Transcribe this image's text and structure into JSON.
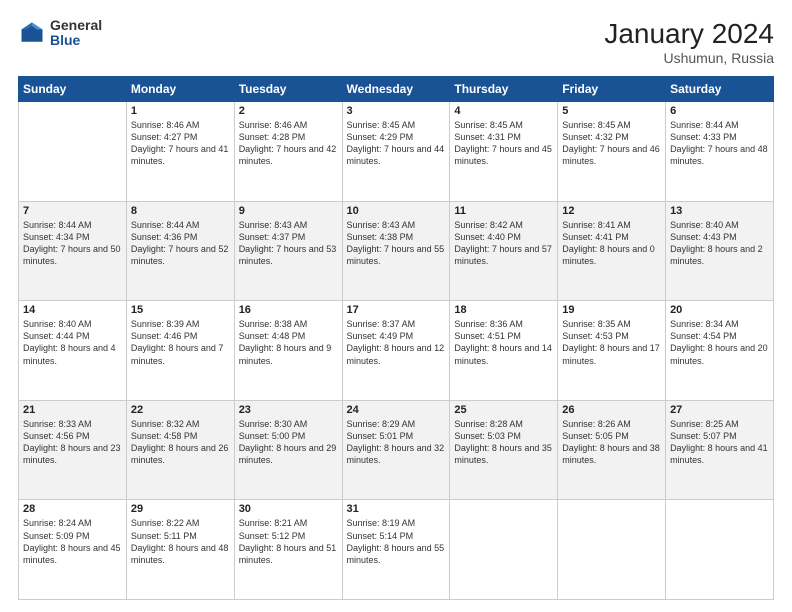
{
  "header": {
    "logo_general": "General",
    "logo_blue": "Blue",
    "main_title": "January 2024",
    "subtitle": "Ushumun, Russia"
  },
  "days_of_week": [
    "Sunday",
    "Monday",
    "Tuesday",
    "Wednesday",
    "Thursday",
    "Friday",
    "Saturday"
  ],
  "weeks": [
    [
      {
        "day": "",
        "sunrise": "",
        "sunset": "",
        "daylight": ""
      },
      {
        "day": "1",
        "sunrise": "Sunrise: 8:46 AM",
        "sunset": "Sunset: 4:27 PM",
        "daylight": "Daylight: 7 hours and 41 minutes."
      },
      {
        "day": "2",
        "sunrise": "Sunrise: 8:46 AM",
        "sunset": "Sunset: 4:28 PM",
        "daylight": "Daylight: 7 hours and 42 minutes."
      },
      {
        "day": "3",
        "sunrise": "Sunrise: 8:45 AM",
        "sunset": "Sunset: 4:29 PM",
        "daylight": "Daylight: 7 hours and 44 minutes."
      },
      {
        "day": "4",
        "sunrise": "Sunrise: 8:45 AM",
        "sunset": "Sunset: 4:31 PM",
        "daylight": "Daylight: 7 hours and 45 minutes."
      },
      {
        "day": "5",
        "sunrise": "Sunrise: 8:45 AM",
        "sunset": "Sunset: 4:32 PM",
        "daylight": "Daylight: 7 hours and 46 minutes."
      },
      {
        "day": "6",
        "sunrise": "Sunrise: 8:44 AM",
        "sunset": "Sunset: 4:33 PM",
        "daylight": "Daylight: 7 hours and 48 minutes."
      }
    ],
    [
      {
        "day": "7",
        "sunrise": "Sunrise: 8:44 AM",
        "sunset": "Sunset: 4:34 PM",
        "daylight": "Daylight: 7 hours and 50 minutes."
      },
      {
        "day": "8",
        "sunrise": "Sunrise: 8:44 AM",
        "sunset": "Sunset: 4:36 PM",
        "daylight": "Daylight: 7 hours and 52 minutes."
      },
      {
        "day": "9",
        "sunrise": "Sunrise: 8:43 AM",
        "sunset": "Sunset: 4:37 PM",
        "daylight": "Daylight: 7 hours and 53 minutes."
      },
      {
        "day": "10",
        "sunrise": "Sunrise: 8:43 AM",
        "sunset": "Sunset: 4:38 PM",
        "daylight": "Daylight: 7 hours and 55 minutes."
      },
      {
        "day": "11",
        "sunrise": "Sunrise: 8:42 AM",
        "sunset": "Sunset: 4:40 PM",
        "daylight": "Daylight: 7 hours and 57 minutes."
      },
      {
        "day": "12",
        "sunrise": "Sunrise: 8:41 AM",
        "sunset": "Sunset: 4:41 PM",
        "daylight": "Daylight: 8 hours and 0 minutes."
      },
      {
        "day": "13",
        "sunrise": "Sunrise: 8:40 AM",
        "sunset": "Sunset: 4:43 PM",
        "daylight": "Daylight: 8 hours and 2 minutes."
      }
    ],
    [
      {
        "day": "14",
        "sunrise": "Sunrise: 8:40 AM",
        "sunset": "Sunset: 4:44 PM",
        "daylight": "Daylight: 8 hours and 4 minutes."
      },
      {
        "day": "15",
        "sunrise": "Sunrise: 8:39 AM",
        "sunset": "Sunset: 4:46 PM",
        "daylight": "Daylight: 8 hours and 7 minutes."
      },
      {
        "day": "16",
        "sunrise": "Sunrise: 8:38 AM",
        "sunset": "Sunset: 4:48 PM",
        "daylight": "Daylight: 8 hours and 9 minutes."
      },
      {
        "day": "17",
        "sunrise": "Sunrise: 8:37 AM",
        "sunset": "Sunset: 4:49 PM",
        "daylight": "Daylight: 8 hours and 12 minutes."
      },
      {
        "day": "18",
        "sunrise": "Sunrise: 8:36 AM",
        "sunset": "Sunset: 4:51 PM",
        "daylight": "Daylight: 8 hours and 14 minutes."
      },
      {
        "day": "19",
        "sunrise": "Sunrise: 8:35 AM",
        "sunset": "Sunset: 4:53 PM",
        "daylight": "Daylight: 8 hours and 17 minutes."
      },
      {
        "day": "20",
        "sunrise": "Sunrise: 8:34 AM",
        "sunset": "Sunset: 4:54 PM",
        "daylight": "Daylight: 8 hours and 20 minutes."
      }
    ],
    [
      {
        "day": "21",
        "sunrise": "Sunrise: 8:33 AM",
        "sunset": "Sunset: 4:56 PM",
        "daylight": "Daylight: 8 hours and 23 minutes."
      },
      {
        "day": "22",
        "sunrise": "Sunrise: 8:32 AM",
        "sunset": "Sunset: 4:58 PM",
        "daylight": "Daylight: 8 hours and 26 minutes."
      },
      {
        "day": "23",
        "sunrise": "Sunrise: 8:30 AM",
        "sunset": "Sunset: 5:00 PM",
        "daylight": "Daylight: 8 hours and 29 minutes."
      },
      {
        "day": "24",
        "sunrise": "Sunrise: 8:29 AM",
        "sunset": "Sunset: 5:01 PM",
        "daylight": "Daylight: 8 hours and 32 minutes."
      },
      {
        "day": "25",
        "sunrise": "Sunrise: 8:28 AM",
        "sunset": "Sunset: 5:03 PM",
        "daylight": "Daylight: 8 hours and 35 minutes."
      },
      {
        "day": "26",
        "sunrise": "Sunrise: 8:26 AM",
        "sunset": "Sunset: 5:05 PM",
        "daylight": "Daylight: 8 hours and 38 minutes."
      },
      {
        "day": "27",
        "sunrise": "Sunrise: 8:25 AM",
        "sunset": "Sunset: 5:07 PM",
        "daylight": "Daylight: 8 hours and 41 minutes."
      }
    ],
    [
      {
        "day": "28",
        "sunrise": "Sunrise: 8:24 AM",
        "sunset": "Sunset: 5:09 PM",
        "daylight": "Daylight: 8 hours and 45 minutes."
      },
      {
        "day": "29",
        "sunrise": "Sunrise: 8:22 AM",
        "sunset": "Sunset: 5:11 PM",
        "daylight": "Daylight: 8 hours and 48 minutes."
      },
      {
        "day": "30",
        "sunrise": "Sunrise: 8:21 AM",
        "sunset": "Sunset: 5:12 PM",
        "daylight": "Daylight: 8 hours and 51 minutes."
      },
      {
        "day": "31",
        "sunrise": "Sunrise: 8:19 AM",
        "sunset": "Sunset: 5:14 PM",
        "daylight": "Daylight: 8 hours and 55 minutes."
      },
      {
        "day": "",
        "sunrise": "",
        "sunset": "",
        "daylight": ""
      },
      {
        "day": "",
        "sunrise": "",
        "sunset": "",
        "daylight": ""
      },
      {
        "day": "",
        "sunrise": "",
        "sunset": "",
        "daylight": ""
      }
    ]
  ]
}
